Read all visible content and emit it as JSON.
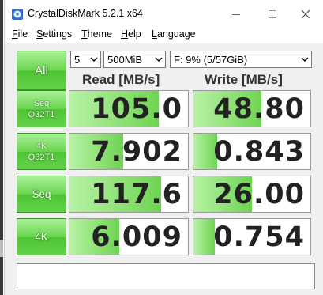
{
  "window": {
    "title": "CrystalDiskMark 5.2.1 x64"
  },
  "menu": [
    "File",
    "Settings",
    "Theme",
    "Help",
    "Language"
  ],
  "controls": {
    "all_label": "All",
    "count": "5",
    "size": "500MiB",
    "drive": "F: 9% (5/57GiB)"
  },
  "headers": {
    "read": "Read [MB/s]",
    "write": "Write [MB/s]"
  },
  "rows": [
    {
      "label_line1": "Seq",
      "label_line2": "Q32T1",
      "read": "105.0",
      "write": "48.80",
      "read_fill": 0.75,
      "write_fill": 0.58
    },
    {
      "label_line1": "4K",
      "label_line2": "Q32T1",
      "read": "7.902",
      "write": "0.843",
      "read_fill": 0.45,
      "write_fill": 0.2
    },
    {
      "label_line1": "Seq",
      "label_line2": "",
      "read": "117.6",
      "write": "26.00",
      "read_fill": 0.77,
      "write_fill": 0.5
    },
    {
      "label_line1": "4K",
      "label_line2": "",
      "read": "6.009",
      "write": "0.754",
      "read_fill": 0.42,
      "write_fill": 0.18
    }
  ],
  "comment": ""
}
